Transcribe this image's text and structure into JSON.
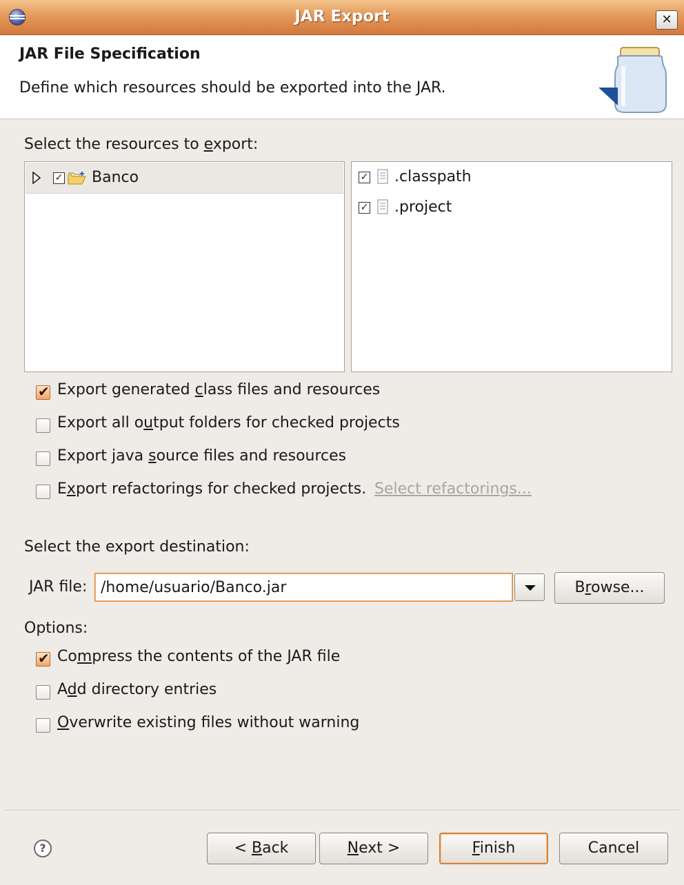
{
  "window": {
    "title": "JAR Export"
  },
  "header": {
    "title": "JAR File Specification",
    "description": "Define which resources should be exported into the JAR."
  },
  "resources": {
    "label_pre": "Select the resources to ",
    "label_key": "e",
    "label_post": "xport:",
    "tree": [
      {
        "label": "Banco",
        "checked": true,
        "expanded": false
      }
    ],
    "files": [
      {
        "label": ".classpath",
        "checked": true
      },
      {
        "label": ".project",
        "checked": true
      }
    ]
  },
  "export_options": [
    {
      "pre": "Export generated ",
      "key": "c",
      "post": "lass files and resources",
      "checked": true
    },
    {
      "pre": "Export all o",
      "key": "u",
      "post": "tput folders for checked projects",
      "checked": false
    },
    {
      "pre": "Export java ",
      "key": "s",
      "post": "ource files and resources",
      "checked": false
    },
    {
      "pre": "E",
      "key": "x",
      "post": "port refactorings for checked projects.",
      "checked": false
    }
  ],
  "select_refactorings_link": "Select refactorings...",
  "destination": {
    "label": "Select the export destination:",
    "jar_label_key": "J",
    "jar_label_post": "AR file:",
    "jar_path": "/home/usuario/Banco.jar",
    "browse_pre": "B",
    "browse_key": "r",
    "browse_post": "owse..."
  },
  "options": {
    "label": "Options:",
    "items": [
      {
        "pre": "Co",
        "key": "m",
        "post": "press the contents of the JAR file",
        "checked": true
      },
      {
        "pre": "A",
        "key": "d",
        "post": "d directory entries",
        "checked": false
      },
      {
        "pre": "",
        "key": "O",
        "post": "verwrite existing files without warning",
        "checked": false
      }
    ]
  },
  "buttons": {
    "help": "?",
    "back_pre": "< ",
    "back_key": "B",
    "back_post": "ack",
    "next_pre": "",
    "next_key": "N",
    "next_post": "ext >",
    "finish_key": "F",
    "finish_post": "inish",
    "cancel": "Cancel"
  },
  "colors": {
    "titlebar": "#e5995a",
    "accent": "#d6813a",
    "background": "#efebe7"
  }
}
